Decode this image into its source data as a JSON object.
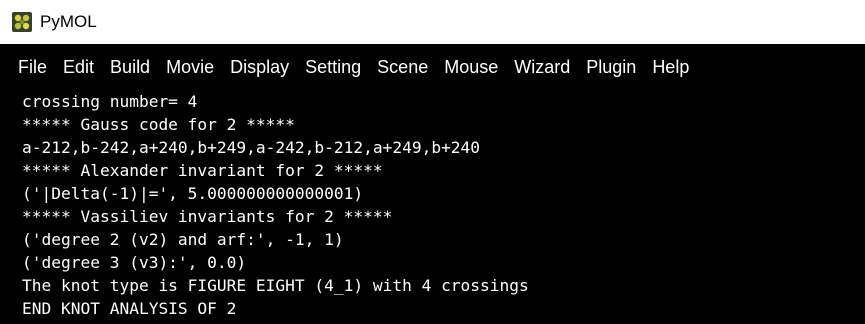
{
  "window": {
    "title": "PyMOL",
    "icon": "pymol-app-icon"
  },
  "menubar": {
    "items": [
      {
        "label": "File"
      },
      {
        "label": "Edit"
      },
      {
        "label": "Build"
      },
      {
        "label": "Movie"
      },
      {
        "label": "Display"
      },
      {
        "label": "Setting"
      },
      {
        "label": "Scene"
      },
      {
        "label": "Mouse"
      },
      {
        "label": "Wizard"
      },
      {
        "label": "Plugin"
      },
      {
        "label": "Help"
      }
    ]
  },
  "console": {
    "lines": [
      "crossing number= 4",
      "***** Gauss code for 2 *****",
      "a-212,b-242,a+240,b+249,a-242,b-212,a+249,b+240",
      "***** Alexander invariant for 2 *****",
      "('|Delta(-1)|=', 5.000000000000001)",
      "***** Vassiliev invariants for 2 *****",
      "('degree 2 (v2) and arf:', -1, 1)",
      "('degree 3 (v3):', 0.0)",
      "The knot type is FIGURE EIGHT (4_1) with 4 crossings",
      "END KNOT ANALYSIS OF 2"
    ]
  },
  "colors": {
    "background": "#000000",
    "text": "#ffffff",
    "titlebar": "#ffffff"
  }
}
